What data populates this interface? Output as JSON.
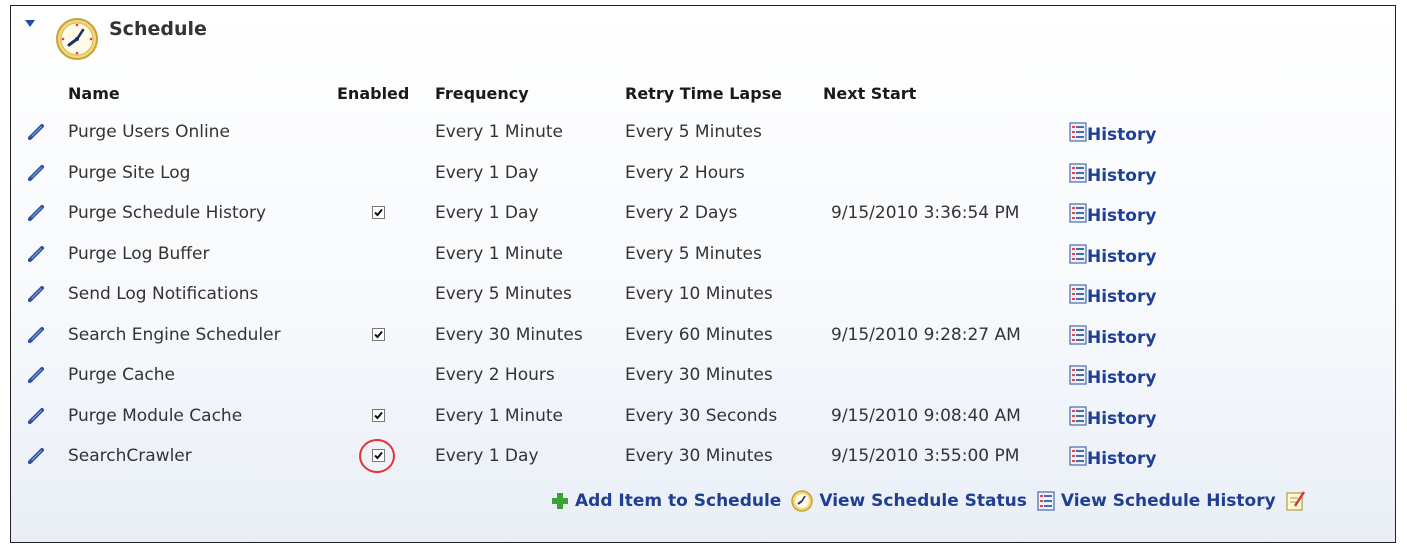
{
  "section": {
    "title": "Schedule"
  },
  "columns": {
    "name": "Name",
    "enabled": "Enabled",
    "frequency": "Frequency",
    "retry": "Retry Time Lapse",
    "next_start": "Next Start"
  },
  "rows": [
    {
      "name": "Purge Users Online",
      "enabled": false,
      "frequency": "Every 1 Minute",
      "retry": "Every 5 Minutes",
      "next_start": "",
      "history": "History"
    },
    {
      "name": "Purge Site Log",
      "enabled": false,
      "frequency": "Every 1 Day",
      "retry": "Every 2 Hours",
      "next_start": "",
      "history": "History"
    },
    {
      "name": "Purge Schedule History",
      "enabled": true,
      "frequency": "Every 1 Day",
      "retry": "Every 2 Days",
      "next_start": "9/15/2010 3:36:54 PM",
      "history": "History"
    },
    {
      "name": "Purge Log Buffer",
      "enabled": false,
      "frequency": "Every 1 Minute",
      "retry": "Every 5 Minutes",
      "next_start": "",
      "history": "History"
    },
    {
      "name": "Send Log Notifications",
      "enabled": false,
      "frequency": "Every 5 Minutes",
      "retry": "Every 10 Minutes",
      "next_start": "",
      "history": "History"
    },
    {
      "name": "Search Engine Scheduler",
      "enabled": true,
      "frequency": "Every 30 Minutes",
      "retry": "Every 60 Minutes",
      "next_start": "9/15/2010 9:28:27 AM",
      "history": "History"
    },
    {
      "name": "Purge Cache",
      "enabled": false,
      "frequency": "Every 2 Hours",
      "retry": "Every 30 Minutes",
      "next_start": "",
      "history": "History"
    },
    {
      "name": "Purge Module Cache",
      "enabled": true,
      "frequency": "Every 1 Minute",
      "retry": "Every 30 Seconds",
      "next_start": "9/15/2010 9:08:40 AM",
      "history": "History"
    },
    {
      "name": "SearchCrawler",
      "enabled": true,
      "frequency": "Every 1 Day",
      "retry": "Every 30 Minutes",
      "next_start": "9/15/2010 3:55:00 PM",
      "history": "History",
      "highlighted": true
    }
  ],
  "footer": {
    "add_item": "Add Item to Schedule",
    "view_status": "View Schedule Status",
    "view_history": "View Schedule History"
  },
  "icons": {
    "section": "clock-icon",
    "edit": "pencil-icon",
    "history": "list-icon",
    "add": "plus-icon",
    "status": "clock-icon",
    "history_footer": "list-icon",
    "edit_page": "edit-note-icon"
  },
  "colors": {
    "link": "#1f3f94",
    "highlight": "#e53333",
    "add_icon": "#3aa335"
  }
}
